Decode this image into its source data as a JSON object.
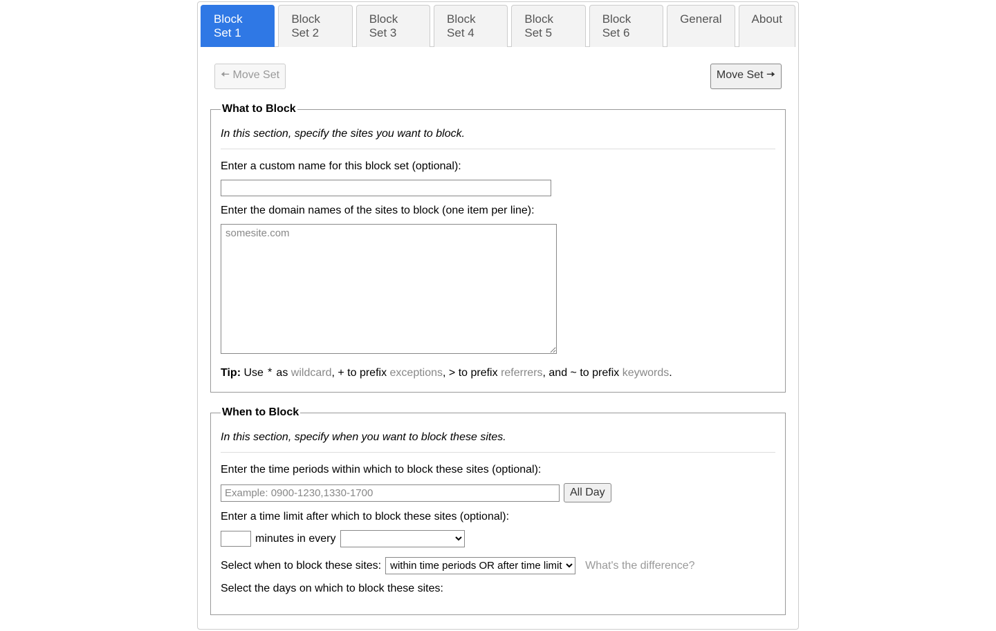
{
  "tabs": [
    {
      "label": "Block Set 1"
    },
    {
      "label": "Block Set 2"
    },
    {
      "label": "Block Set 3"
    },
    {
      "label": "Block Set 4"
    },
    {
      "label": "Block Set 5"
    },
    {
      "label": "Block Set 6"
    },
    {
      "label": "General"
    },
    {
      "label": "About"
    }
  ],
  "moveSetLeft": "🠄 Move Set",
  "moveSetRight": "Move Set 🠆",
  "whatToBlock": {
    "legend": "What to Block",
    "desc": "In this section, specify the sites you want to block.",
    "customNameLabel": "Enter a custom name for this block set (optional):",
    "customNameValue": "",
    "domainsLabel": "Enter the domain names of the sites to block (one item per line):",
    "domainsPlaceholder": "somesite.com",
    "domainsValue": "",
    "tipLabel": "Tip:",
    "tipUse": " Use ",
    "tipStar": "*",
    "tipAs": " as ",
    "tipWildcard": "wildcard",
    "tipPlusPrefix": ", + to prefix ",
    "tipExceptions": "exceptions",
    "tipGtPrefix": ", > to prefix ",
    "tipReferrers": "referrers",
    "tipTildePrefix": ", and ~ to prefix ",
    "tipKeywords": "keywords",
    "tipEnd": "."
  },
  "whenToBlock": {
    "legend": "When to Block",
    "desc": "In this section, specify when you want to block these sites.",
    "timePeriodsLabel": "Enter the time periods within which to block these sites (optional):",
    "timePeriodsPlaceholder": "Example: 0900-1230,1330-1700",
    "timePeriodsValue": "",
    "allDay": "All Day",
    "timeLimitLabel": "Enter a time limit after which to block these sites (optional):",
    "minutesValue": "",
    "minutesText": "minutes in every",
    "periodSelectValue": "",
    "whenSelectLabel": "Select when to block these sites:",
    "whenSelectValue": "within time periods OR after time limit",
    "whatsDifference": "What's the difference?",
    "daysLabel": "Select the days on which to block these sites:"
  }
}
